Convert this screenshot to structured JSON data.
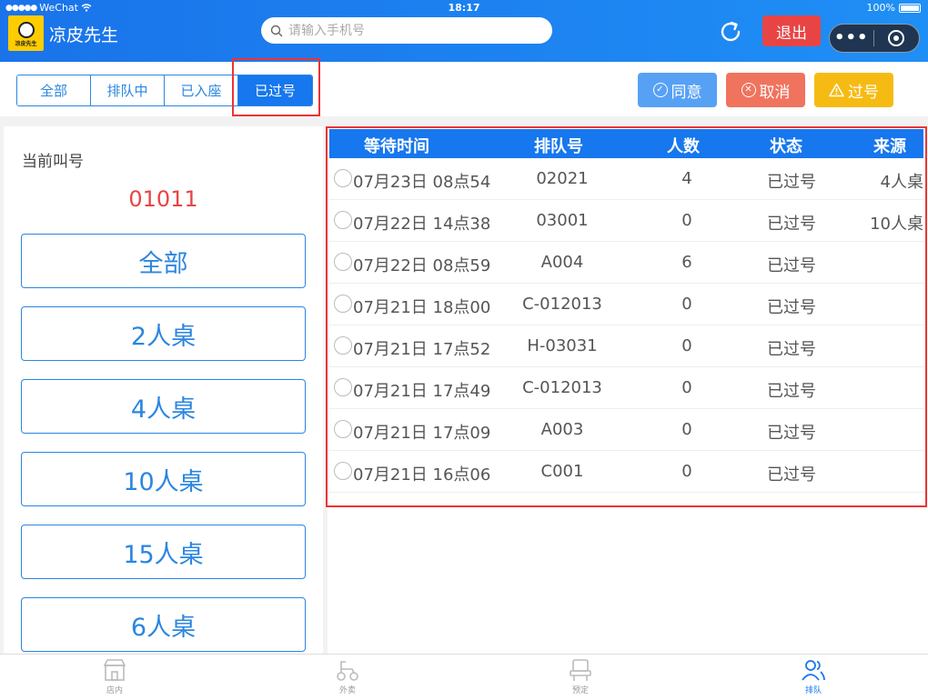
{
  "status_bar": {
    "carrier": "WeChat",
    "time": "18:17",
    "battery": "100%"
  },
  "header": {
    "brand": "凉皮先生",
    "logo_text": "凉皮先生",
    "search_placeholder": "请输入手机号",
    "logout_label": "退出"
  },
  "tabs": [
    {
      "label": "全部"
    },
    {
      "label": "排队中"
    },
    {
      "label": "已入座"
    },
    {
      "label": "已过号"
    }
  ],
  "active_tab": "已过号",
  "actions": {
    "agree": "同意",
    "cancel": "取消",
    "pass": "过号"
  },
  "left": {
    "current_label": "当前叫号",
    "current_number": "01011",
    "tables": [
      "全部",
      "2人桌",
      "4人桌",
      "10人桌",
      "15人桌",
      "6人桌"
    ]
  },
  "list": {
    "headers": [
      "等待时间",
      "排队号",
      "人数",
      "状态",
      "来源"
    ],
    "rows": [
      {
        "time": "07月23日 08点54",
        "number": "02021",
        "people": "4",
        "status": "已过号",
        "source": "4人桌"
      },
      {
        "time": "07月22日 14点38",
        "number": "03001",
        "people": "0",
        "status": "已过号",
        "source": "10人桌"
      },
      {
        "time": "07月22日 08点59",
        "number": "A004",
        "people": "6",
        "status": "已过号",
        "source": ""
      },
      {
        "time": "07月21日 18点00",
        "number": "C-012013",
        "people": "0",
        "status": "已过号",
        "source": ""
      },
      {
        "time": "07月21日 17点52",
        "number": "H-03031",
        "people": "0",
        "status": "已过号",
        "source": ""
      },
      {
        "time": "07月21日 17点49",
        "number": "C-012013",
        "people": "0",
        "status": "已过号",
        "source": ""
      },
      {
        "time": "07月21日 17点09",
        "number": "A003",
        "people": "0",
        "status": "已过号",
        "source": ""
      },
      {
        "time": "07月21日 16点06",
        "number": "C001",
        "people": "0",
        "status": "已过号",
        "source": ""
      }
    ]
  },
  "bottom_nav": [
    {
      "label": "店内",
      "icon": "store-icon"
    },
    {
      "label": "外卖",
      "icon": "scooter-icon"
    },
    {
      "label": "预定",
      "icon": "chair-icon"
    },
    {
      "label": "排队",
      "icon": "users-icon"
    }
  ],
  "colors": {
    "primary": "#1677ee",
    "danger": "#e84444",
    "warning": "#f6bb13",
    "cancel": "#f0735e",
    "agree": "#57a1f5"
  }
}
